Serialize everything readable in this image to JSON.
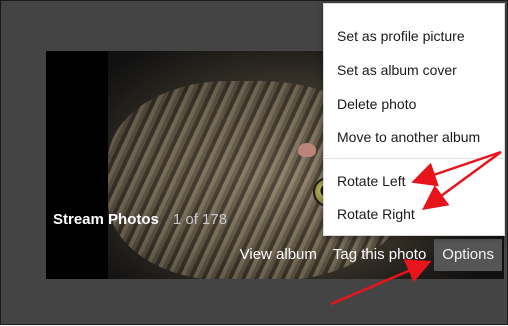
{
  "viewer": {
    "title": "Stream Photos",
    "counter": "1 of 178"
  },
  "actions": {
    "view_album": "View album",
    "tag_photo": "Tag this photo",
    "options": "Options"
  },
  "options_menu": {
    "items": [
      "Set as profile picture",
      "Set as album cover",
      "Delete photo",
      "Move to another album",
      "Rotate Left",
      "Rotate Right"
    ]
  },
  "colors": {
    "annotation_arrow": "#e8141b",
    "page_background": "#444444",
    "menu_background": "#ffffff"
  }
}
